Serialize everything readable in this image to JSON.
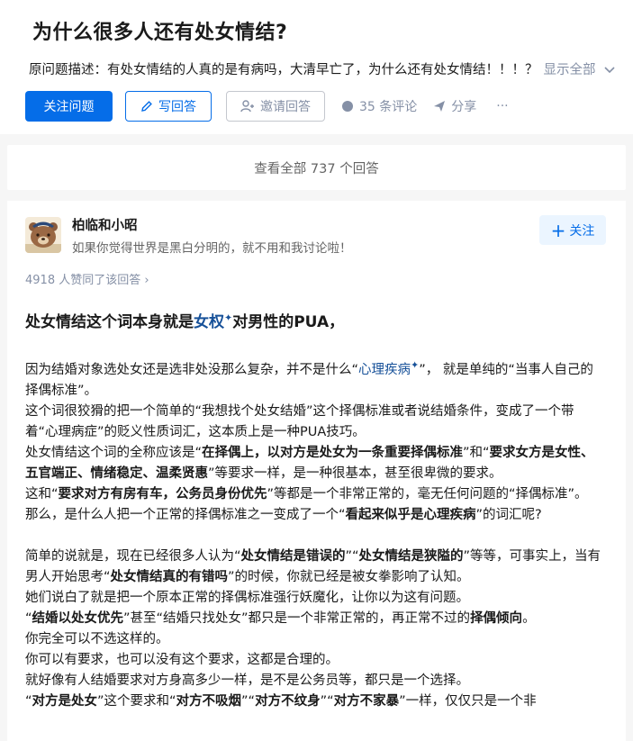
{
  "question": {
    "title": "为什么很多人还有处女情结?",
    "description": "原问题描述：有处女情结的人真的是有病吗，大清早亡了，为什么还有处女情结！！！？",
    "show_all": "显示全部"
  },
  "actions": {
    "follow_question": "关注问题",
    "write_answer": "写回答",
    "invite_answer": "邀请回答",
    "comments": "35 条评论",
    "share": "分享",
    "more": "···"
  },
  "view_all": "查看全部 737 个回答",
  "answer": {
    "author_name": "柏临和小昭",
    "author_bio": "如果你觉得世界是黑白分明的，就不用和我讨论啦！",
    "follow": "关注",
    "votes": "4918 人赞同了该回答",
    "vote_chevron": "›",
    "heading": {
      "a": "处女情结这个词本身就是",
      "link": "女权",
      "b": "对男性的PUA，"
    },
    "p1": {
      "a": "因为结婚对象选处女还是选非处没那么复杂，并不是什么“",
      "link": "心理疾病",
      "b": "”， 就是单纯的“当事人自己的择偶标准”。"
    },
    "p2": "这个词很狡猾的把一个简单的“我想找个处女结婚”这个择偶标准或者说结婚条件，变成了一个带着“心理病症”的贬义性质词汇，这本质上是一种PUA技巧。",
    "p3": {
      "a": "处女情结这个词的全称应该是“",
      "b1": "在择偶上，以对方是处女为一条重要择偶标准",
      "c": "”和“",
      "b2": "要求女方是女性、五官端正、情绪稳定、温柔贤惠",
      "d": "”等要求一样，是一种很基本，甚至很卑微的要求。"
    },
    "p4": {
      "a": "这和“",
      "b": "要求对方有房有车，公务员身份优先",
      "c": "”等都是一个非常正常的，毫无任何问题的“择偶标准”。"
    },
    "p5": {
      "a": "那么，是什么人把一个正常的择偶标准之一变成了一个“",
      "b": "看起来似乎是心理疾病",
      "c": "”的词汇呢?"
    },
    "p6": {
      "a": "简单的说就是，现在已经很多人认为“",
      "b1": "处女情结是错误的",
      "c": "”“",
      "b2": "处女情结是狭隘的",
      "d": "”等等，可事实上，当有男人开始思考“",
      "b3": "处女情结真的有错吗",
      "e": "”的时候，你就已经是被女拳影响了认知。"
    },
    "p7": "她们说白了就是把一个原本正常的择偶标准强行妖魔化，让你以为这有问题。",
    "p8": {
      "a": "“",
      "b1": "结婚以处女优先",
      "c": "”甚至“结婚只找处女”都只是一个非常正常的，再正常不过的",
      "b2": "择偶倾向",
      "d": "。"
    },
    "p9": "你完全可以不选这样的。",
    "p10": "你可以有要求，也可以没有这个要求，这都是合理的。",
    "p11": "就好像有人结婚要求对方身高多少一样，是不是公务员等，都只是一个选择。",
    "p12": {
      "a": "“",
      "b1": "对方是处女",
      "c": "”这个要求和“",
      "b2": "对方不吸烟",
      "d": "”“",
      "b3": "对方不纹身",
      "e": "”“",
      "b4": "对方不家暴",
      "f": "”一样，仅仅只是一个非"
    }
  },
  "colors": {
    "brand": "#056de8",
    "link": "#175199",
    "muted": "#8590a6",
    "background": "#f6f6f6"
  }
}
